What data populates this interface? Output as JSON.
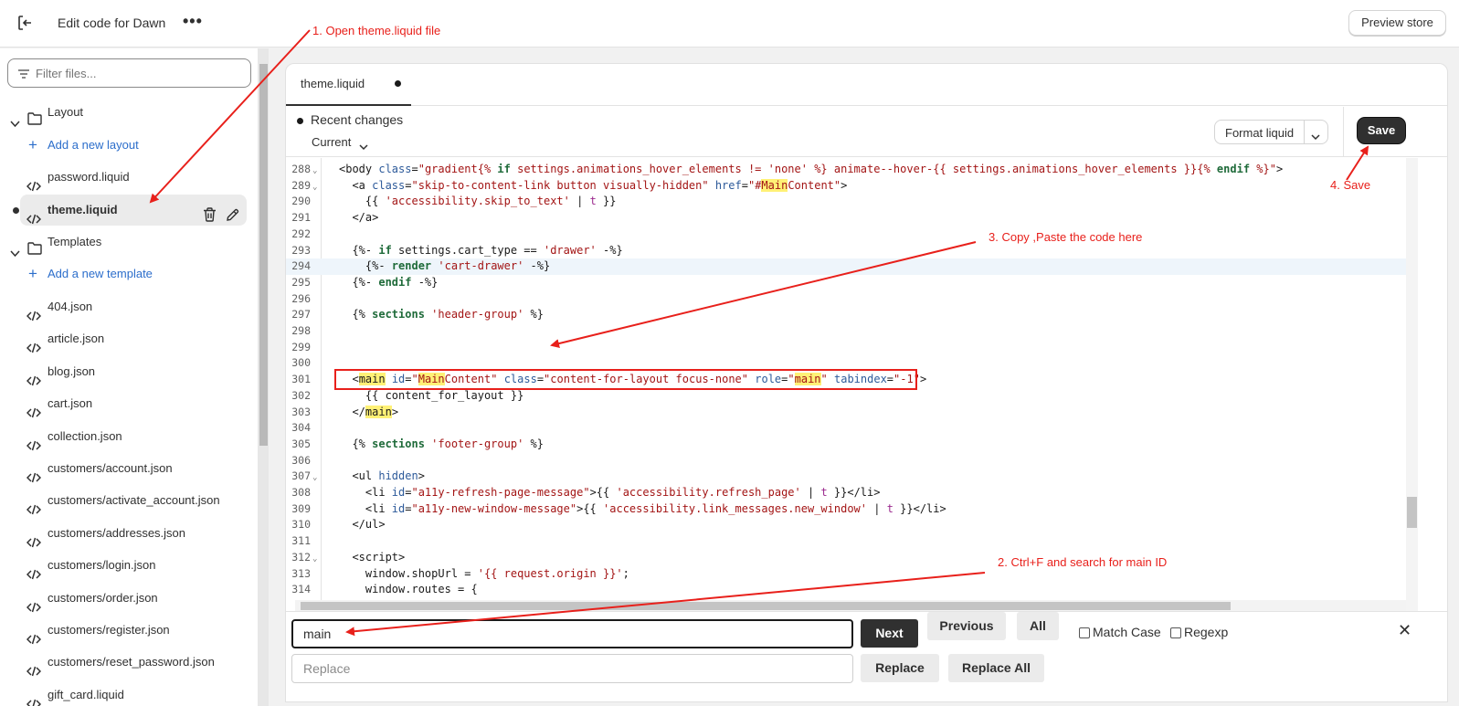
{
  "topbar": {
    "title": "Edit code for Dawn",
    "more": "•••",
    "preview_label": "Preview store"
  },
  "sidebar": {
    "filter_placeholder": "Filter files...",
    "layout_folder": "Layout",
    "add_layout": "Add a new layout",
    "password_file": "password.liquid",
    "theme_file": "theme.liquid",
    "templates_folder": "Templates",
    "add_template": "Add a new template",
    "template_files": [
      "404.json",
      "article.json",
      "blog.json",
      "cart.json",
      "collection.json",
      "customers/account.json",
      "customers/activate_account.json",
      "customers/addresses.json",
      "customers/login.json",
      "customers/order.json",
      "customers/register.json",
      "customers/reset_password.json",
      "gift_card.liquid"
    ]
  },
  "editor": {
    "tab_label": "theme.liquid",
    "recent_changes": "Recent changes",
    "current_label": "Current",
    "format_label": "Format liquid",
    "save_label": "Save",
    "line_numbers": [
      "288",
      "289",
      "290",
      "291",
      "292",
      "293",
      "294",
      "295",
      "296",
      "297",
      "298",
      "299",
      "300",
      "301",
      "302",
      "303",
      "304",
      "305",
      "306",
      "307",
      "308",
      "309",
      "310",
      "311",
      "312",
      "313",
      "314"
    ]
  },
  "search": {
    "find_value": "main",
    "replace_placeholder": "Replace",
    "next": "Next",
    "previous": "Previous",
    "all": "All",
    "match_case": "Match Case",
    "regexp": "Regexp",
    "replace": "Replace",
    "replace_all": "Replace All",
    "close": "✕"
  },
  "annotations": {
    "step1": "1. Open theme.liquid file",
    "step2": "2. Ctrl+F and search for main ID",
    "step3": "3. Copy ,Paste the code here",
    "step4": "4. Save"
  },
  "colors": {
    "annotation": "#e8201b",
    "link": "#2c6ecb",
    "save_bg": "#303030",
    "highlight_line": "#eef5fb",
    "match": "#fff176"
  }
}
